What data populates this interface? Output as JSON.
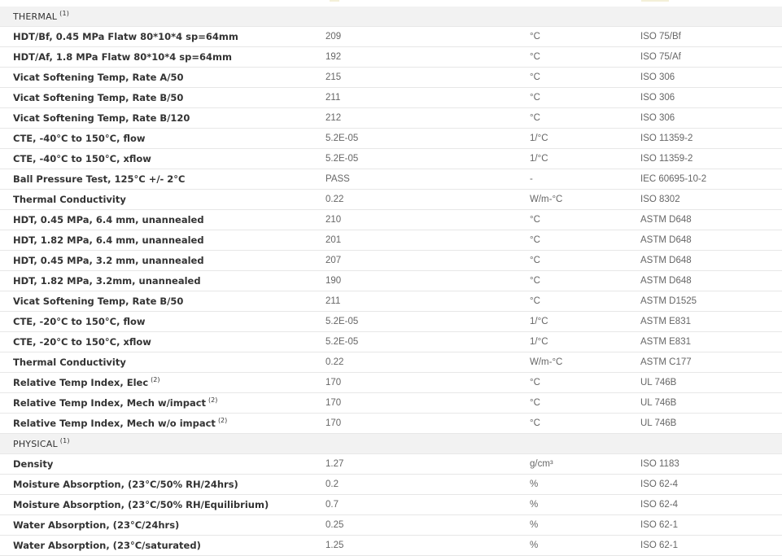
{
  "sections": [
    {
      "title": "THERMAL",
      "note": "(1)",
      "rows": [
        {
          "name": "HDT/Bf, 0.45 MPa Flatw 80*10*4 sp=64mm",
          "note": "",
          "value": "209",
          "unit": "°C",
          "standard": "ISO 75/Bf"
        },
        {
          "name": "HDT/Af, 1.8 MPa Flatw 80*10*4 sp=64mm",
          "note": "",
          "value": "192",
          "unit": "°C",
          "standard": "ISO 75/Af"
        },
        {
          "name": "Vicat Softening Temp, Rate A/50",
          "note": "",
          "value": "215",
          "unit": "°C",
          "standard": "ISO 306"
        },
        {
          "name": "Vicat Softening Temp, Rate B/50",
          "note": "",
          "value": "211",
          "unit": "°C",
          "standard": "ISO 306"
        },
        {
          "name": "Vicat Softening Temp, Rate B/120",
          "note": "",
          "value": "212",
          "unit": "°C",
          "standard": "ISO 306"
        },
        {
          "name": "CTE, -40°C to 150°C, flow",
          "note": "",
          "value": "5.2E-05",
          "unit": "1/°C",
          "standard": "ISO 11359-2"
        },
        {
          "name": "CTE, -40°C to 150°C, xflow",
          "note": "",
          "value": "5.2E-05",
          "unit": "1/°C",
          "standard": "ISO 11359-2"
        },
        {
          "name": "Ball Pressure Test, 125°C +/- 2°C",
          "note": "",
          "value": "PASS",
          "unit": "-",
          "standard": "IEC 60695-10-2"
        },
        {
          "name": "Thermal Conductivity",
          "note": "",
          "value": "0.22",
          "unit": "W/m-°C",
          "standard": "ISO 8302"
        },
        {
          "name": "HDT, 0.45 MPa, 6.4 mm, unannealed",
          "note": "",
          "value": "210",
          "unit": "°C",
          "standard": "ASTM D648"
        },
        {
          "name": "HDT, 1.82 MPa, 6.4 mm, unannealed",
          "note": "",
          "value": "201",
          "unit": "°C",
          "standard": "ASTM D648"
        },
        {
          "name": "HDT, 0.45 MPa, 3.2 mm, unannealed",
          "note": "",
          "value": "207",
          "unit": "°C",
          "standard": "ASTM D648"
        },
        {
          "name": "HDT, 1.82 MPa, 3.2mm, unannealed",
          "note": "",
          "value": "190",
          "unit": "°C",
          "standard": "ASTM D648"
        },
        {
          "name": "Vicat Softening Temp, Rate B/50",
          "note": "",
          "value": "211",
          "unit": "°C",
          "standard": "ASTM D1525"
        },
        {
          "name": "CTE, -20°C to 150°C, flow",
          "note": "",
          "value": "5.2E-05",
          "unit": "1/°C",
          "standard": "ASTM E831"
        },
        {
          "name": "CTE, -20°C to 150°C, xflow",
          "note": "",
          "value": "5.2E-05",
          "unit": "1/°C",
          "standard": "ASTM E831"
        },
        {
          "name": "Thermal Conductivity",
          "note": "",
          "value": "0.22",
          "unit": "W/m-°C",
          "standard": "ASTM C177"
        },
        {
          "name": "Relative Temp Index, Elec",
          "note": "(2)",
          "value": "170",
          "unit": "°C",
          "standard": "UL 746B"
        },
        {
          "name": "Relative Temp Index, Mech w/impact",
          "note": "(2)",
          "value": "170",
          "unit": "°C",
          "standard": "UL 746B"
        },
        {
          "name": "Relative Temp Index, Mech w/o impact",
          "note": "(2)",
          "value": "170",
          "unit": "°C",
          "standard": "UL 746B"
        }
      ]
    },
    {
      "title": "PHYSICAL",
      "note": "(1)",
      "rows": [
        {
          "name": "Density",
          "note": "",
          "value": "1.27",
          "unit": "g/cm³",
          "standard": "ISO 1183"
        },
        {
          "name": "Moisture Absorption, (23°C/50% RH/24hrs)",
          "note": "",
          "value": "0.2",
          "unit": "%",
          "standard": "ISO 62-4"
        },
        {
          "name": "Moisture Absorption, (23°C/50% RH/Equilibrium)",
          "note": "",
          "value": "0.7",
          "unit": "%",
          "standard": "ISO 62-4"
        },
        {
          "name": "Water Absorption, (23°C/24hrs)",
          "note": "",
          "value": "0.25",
          "unit": "%",
          "standard": "ISO 62-1"
        },
        {
          "name": "Water Absorption, (23°C/saturated)",
          "note": "",
          "value": "1.25",
          "unit": "%",
          "standard": "ISO 62-1"
        }
      ]
    }
  ],
  "colors": {
    "section_bg": "#f2f2f2",
    "row_border": "#e7e7e7",
    "name_text": "#333333",
    "value_text": "#666666"
  }
}
